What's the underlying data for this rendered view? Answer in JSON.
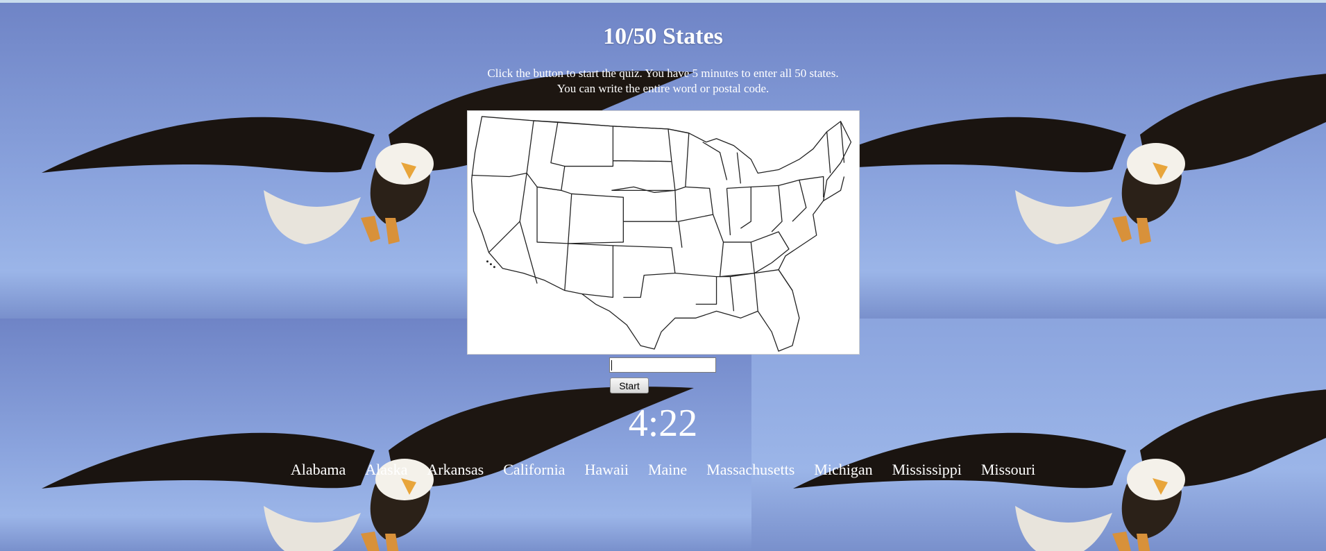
{
  "quiz": {
    "score": "10/50 States",
    "instruction_line1": "Click the button to start the quiz. You have 5 minutes to enter all 50 states.",
    "instruction_line2": "You can write the entire word or postal code.",
    "answer_value": "",
    "start_label": "Start",
    "timer": "4:22",
    "found_states": [
      "Alabama",
      "Alaska",
      "Arkansas",
      "California",
      "Hawaii",
      "Maine",
      "Massachusetts",
      "Michigan",
      "Mississippi",
      "Missouri"
    ]
  },
  "colors": {
    "sky": "#7f96cf",
    "text": "#ffffff",
    "map_bg": "#ffffff"
  },
  "icons": {
    "background": "bald-eagle-tile",
    "map": "us-states-outline-map"
  }
}
